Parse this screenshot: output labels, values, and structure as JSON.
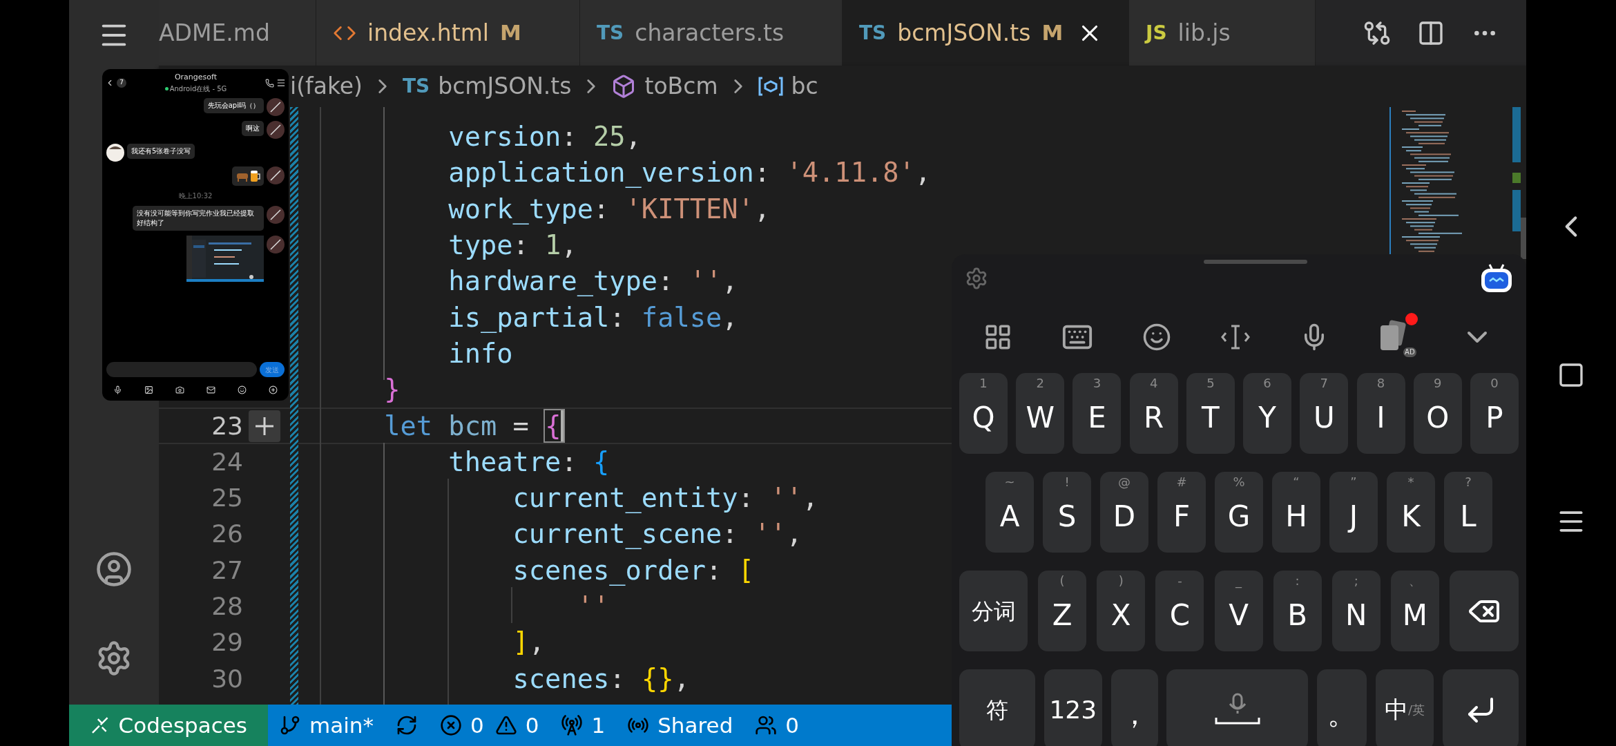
{
  "tabs": [
    {
      "label": "ADME.md",
      "icon": {
        "kind": "none"
      },
      "selected": false
    },
    {
      "label": "index.html",
      "icon": {
        "kind": "html"
      },
      "badge": "M",
      "selected": false
    },
    {
      "label": "characters.ts",
      "icon": {
        "kind": "ts",
        "text": "TS"
      },
      "selected": false
    },
    {
      "label": "bcmJSON.ts",
      "icon": {
        "kind": "ts",
        "text": "TS"
      },
      "badge": "M",
      "selected": true
    },
    {
      "label": "lib.js",
      "icon": {
        "kind": "js",
        "text": "JS"
      },
      "selected": false
    }
  ],
  "breadcrumb": [
    {
      "text": "i(fake)",
      "icon": {
        "kind": "none"
      }
    },
    {
      "text": "bcmJSON.ts",
      "icon": {
        "kind": "ts",
        "text": "TS"
      }
    },
    {
      "text": "toBcm",
      "icon": {
        "kind": "function"
      }
    },
    {
      "text": "bc",
      "icon": {
        "kind": "variable"
      }
    }
  ],
  "code_lines": [
    {
      "current": false,
      "tokens": [
        {
          "text": "        version",
          "kind": "key"
        },
        {
          "text": ": ",
          "kind": "punct"
        },
        {
          "text": "25",
          "kind": "number"
        },
        {
          "text": ",",
          "kind": "punct"
        }
      ]
    },
    {
      "current": false,
      "tokens": [
        {
          "text": "        application_version",
          "kind": "key"
        },
        {
          "text": ": ",
          "kind": "punct"
        },
        {
          "text": "'4.11.8'",
          "kind": "string"
        },
        {
          "text": ",",
          "kind": "punct"
        }
      ]
    },
    {
      "current": false,
      "tokens": [
        {
          "text": "        work_type",
          "kind": "key"
        },
        {
          "text": ": ",
          "kind": "punct"
        },
        {
          "text": "'KITTEN'",
          "kind": "string"
        },
        {
          "text": ",",
          "kind": "punct"
        }
      ]
    },
    {
      "current": false,
      "tokens": [
        {
          "text": "        type",
          "kind": "key"
        },
        {
          "text": ": ",
          "kind": "punct"
        },
        {
          "text": "1",
          "kind": "number"
        },
        {
          "text": ",",
          "kind": "punct"
        }
      ]
    },
    {
      "current": false,
      "tokens": [
        {
          "text": "        hardware_type",
          "kind": "key"
        },
        {
          "text": ": ",
          "kind": "punct"
        },
        {
          "text": "''",
          "kind": "string"
        },
        {
          "text": ",",
          "kind": "punct"
        }
      ]
    },
    {
      "current": false,
      "tokens": [
        {
          "text": "        is_partial",
          "kind": "key"
        },
        {
          "text": ": ",
          "kind": "punct"
        },
        {
          "text": "false",
          "kind": "boolean"
        },
        {
          "text": ",",
          "kind": "punct"
        }
      ]
    },
    {
      "current": false,
      "tokens": [
        {
          "text": "        info",
          "kind": "key"
        }
      ]
    },
    {
      "current": false,
      "tokens": [
        {
          "text": "    }",
          "kind": "brace1"
        }
      ]
    },
    {
      "number": "23",
      "current": true,
      "tokens": [
        {
          "text": "    let",
          "kind": "keyword"
        },
        {
          "text": " bcm",
          "kind": "variable"
        },
        {
          "text": " = ",
          "kind": "punct"
        },
        {
          "text": "{",
          "kind": "brace1",
          "cursor": true
        }
      ]
    },
    {
      "number": "24",
      "current": false,
      "tokens": [
        {
          "text": "        theatre",
          "kind": "key"
        },
        {
          "text": ": ",
          "kind": "punct"
        },
        {
          "text": "{",
          "kind": "brace2"
        }
      ]
    },
    {
      "number": "25",
      "current": false,
      "tokens": [
        {
          "text": "            current_entity",
          "kind": "key"
        },
        {
          "text": ": ",
          "kind": "punct"
        },
        {
          "text": "''",
          "kind": "string"
        },
        {
          "text": ",",
          "kind": "punct"
        }
      ]
    },
    {
      "number": "26",
      "current": false,
      "tokens": [
        {
          "text": "            current_scene",
          "kind": "key"
        },
        {
          "text": ": ",
          "kind": "punct"
        },
        {
          "text": "''",
          "kind": "string"
        },
        {
          "text": ",",
          "kind": "punct"
        }
      ]
    },
    {
      "number": "27",
      "current": false,
      "tokens": [
        {
          "text": "            scenes_order",
          "kind": "key"
        },
        {
          "text": ": ",
          "kind": "punct"
        },
        {
          "text": "[",
          "kind": "brace3"
        }
      ]
    },
    {
      "number": "28",
      "current": false,
      "tokens": [
        {
          "text": "                ''",
          "kind": "string"
        }
      ]
    },
    {
      "number": "29",
      "current": false,
      "tokens": [
        {
          "text": "            ]",
          "kind": "brace3"
        },
        {
          "text": ",",
          "kind": "punct"
        }
      ]
    },
    {
      "number": "30",
      "current": false,
      "tokens": [
        {
          "text": "            scenes",
          "kind": "key"
        },
        {
          "text": ": ",
          "kind": "punct"
        },
        {
          "text": "{}",
          "kind": "brace3"
        },
        {
          "text": ",",
          "kind": "punct"
        }
      ]
    }
  ],
  "status_bar": [
    {
      "kind": "remote",
      "text": "Codespaces"
    },
    {
      "kind": "branch",
      "text": "main*"
    },
    {
      "kind": "sync"
    },
    {
      "kind": "errors",
      "text": "0"
    },
    {
      "kind": "warnings",
      "text": "0"
    },
    {
      "kind": "ports",
      "text": "1"
    },
    {
      "kind": "live",
      "text": "Shared"
    },
    {
      "kind": "people",
      "text": "0"
    }
  ],
  "chat": {
    "title": "Orangesoft",
    "subtitle": "Android在线 - 5G",
    "unread": "7",
    "messages": [
      {
        "kind": "sent-text",
        "text": "先玩会api吗（）"
      },
      {
        "kind": "sent-text",
        "text": "啊这"
      },
      {
        "kind": "received-text",
        "text": "我还有5张卷子没写"
      },
      {
        "kind": "sent-emoji"
      },
      {
        "kind": "time",
        "text": "晚上10:32"
      },
      {
        "kind": "sent-text",
        "text": "没有没可能等到你写完作业我已经提取好结构了"
      },
      {
        "kind": "sent-image"
      }
    ],
    "send": "发送"
  },
  "keyboard": {
    "ad_label": "AD",
    "rows": [
      {
        "keys": [
          {
            "kind": "letter",
            "label": "Q",
            "hint": "1"
          },
          {
            "kind": "letter",
            "label": "W",
            "hint": "2"
          },
          {
            "kind": "letter",
            "label": "E",
            "hint": "3"
          },
          {
            "kind": "letter",
            "label": "R",
            "hint": "4"
          },
          {
            "kind": "letter",
            "label": "T",
            "hint": "5"
          },
          {
            "kind": "letter",
            "label": "Y",
            "hint": "6"
          },
          {
            "kind": "letter",
            "label": "U",
            "hint": "7"
          },
          {
            "kind": "letter",
            "label": "I",
            "hint": "8"
          },
          {
            "kind": "letter",
            "label": "O",
            "hint": "9"
          },
          {
            "kind": "letter",
            "label": "P",
            "hint": "0"
          }
        ]
      },
      {
        "keys": [
          {
            "kind": "letter",
            "label": "A",
            "hint": "~"
          },
          {
            "kind": "letter",
            "label": "S",
            "hint": "!"
          },
          {
            "kind": "letter",
            "label": "D",
            "hint": "@"
          },
          {
            "kind": "letter",
            "label": "F",
            "hint": "#"
          },
          {
            "kind": "letter",
            "label": "G",
            "hint": "%"
          },
          {
            "kind": "letter",
            "label": "H",
            "hint": "“"
          },
          {
            "kind": "letter",
            "label": "J",
            "hint": "”"
          },
          {
            "kind": "letter",
            "label": "K",
            "hint": "*"
          },
          {
            "kind": "letter",
            "label": "L",
            "hint": "?"
          }
        ]
      },
      {
        "keys": [
          {
            "kind": "wide",
            "label": "分词"
          },
          {
            "kind": "letter",
            "label": "Z",
            "hint": "("
          },
          {
            "kind": "letter",
            "label": "X",
            "hint": ")"
          },
          {
            "kind": "letter",
            "label": "C",
            "hint": "-"
          },
          {
            "kind": "letter",
            "label": "V",
            "hint": "_"
          },
          {
            "kind": "letter",
            "label": "B",
            "hint": ":"
          },
          {
            "kind": "letter",
            "label": "N",
            "hint": ";"
          },
          {
            "kind": "letter",
            "label": "M",
            "hint": "、"
          },
          {
            "kind": "backspace"
          }
        ]
      },
      {
        "keys": [
          {
            "kind": "wide",
            "label": "符"
          },
          {
            "kind": "medium",
            "label": "123"
          },
          {
            "kind": "letter",
            "label": "，"
          },
          {
            "kind": "space"
          },
          {
            "kind": "letter",
            "label": "。"
          },
          {
            "kind": "lang",
            "label": "中",
            "hint": "/英"
          },
          {
            "kind": "enter"
          }
        ]
      }
    ]
  }
}
